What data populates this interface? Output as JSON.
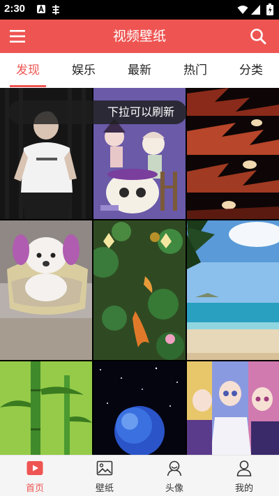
{
  "status_bar": {
    "time": "2:30"
  },
  "app_bar": {
    "title": "视频壁纸",
    "menu_icon": "menu-icon",
    "search_icon": "search-icon"
  },
  "tabs": [
    {
      "label": "发现",
      "active": true
    },
    {
      "label": "娱乐",
      "active": false
    },
    {
      "label": "最新",
      "active": false
    },
    {
      "label": "热门",
      "active": false
    },
    {
      "label": "分类",
      "active": false
    }
  ],
  "refresh_hint": "下拉可以刷新",
  "wallpapers": [
    {
      "subject": "boy in white t-shirt on black background"
    },
    {
      "subject": "anime girls with cauldron on purple background"
    },
    {
      "subject": "red and black anime face pattern"
    },
    {
      "subject": "white poodle with pink ears on a pet bed"
    },
    {
      "subject": "koi fish in a lotus pond"
    },
    {
      "subject": "tropical beach with palm leaves"
    },
    {
      "subject": "green bamboo stalks"
    },
    {
      "subject": "blue glowing planet in starry space"
    },
    {
      "subject": "anime girls group"
    }
  ],
  "bottom_nav": [
    {
      "label": "首页",
      "icon": "play-icon",
      "active": true
    },
    {
      "label": "壁纸",
      "icon": "image-icon",
      "active": false
    },
    {
      "label": "头像",
      "icon": "avatar-icon",
      "active": false
    },
    {
      "label": "我的",
      "icon": "user-icon",
      "active": false
    }
  ],
  "colors": {
    "accent": "#ee5552",
    "nav_bg": "#f5f5f5"
  }
}
